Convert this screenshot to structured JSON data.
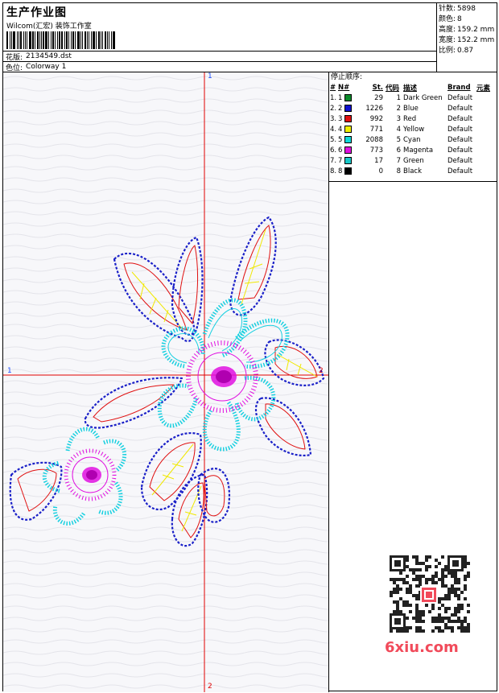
{
  "header": {
    "title": "生产作业图",
    "company": "Wilcom(汇宏) 装饰工作室",
    "file_label": "花版:",
    "file_name": "2134549.dst",
    "colorway_label": "色位:",
    "colorway_name": "Colorway 1"
  },
  "stats": [
    {
      "label": "针数:",
      "value": "5898"
    },
    {
      "label": "颜色:",
      "value": "8"
    },
    {
      "label": "高度:",
      "value": "159.2 mm"
    },
    {
      "label": "宽度:",
      "value": "152.2 mm"
    },
    {
      "label": "比例:",
      "value": "0.87"
    }
  ],
  "color_panel": {
    "title": "停止顺序:",
    "headers": [
      "#",
      "N#",
      "St.",
      "代码",
      "描述",
      "Brand",
      "元素"
    ],
    "rows": [
      {
        "n": "1.",
        "nn": "1",
        "color": "#0a8a2a",
        "st": "29",
        "code": "1",
        "desc": "Dark Green",
        "brand": "Default"
      },
      {
        "n": "2.",
        "nn": "2",
        "color": "#1010d0",
        "st": "1226",
        "code": "2",
        "desc": "Blue",
        "brand": "Default"
      },
      {
        "n": "3.",
        "nn": "3",
        "color": "#e01010",
        "st": "992",
        "code": "3",
        "desc": "Red",
        "brand": "Default"
      },
      {
        "n": "4.",
        "nn": "4",
        "color": "#f0f000",
        "st": "771",
        "code": "4",
        "desc": "Yellow",
        "brand": "Default"
      },
      {
        "n": "5.",
        "nn": "5",
        "color": "#10d8d8",
        "st": "2088",
        "code": "5",
        "desc": "Cyan",
        "brand": "Default"
      },
      {
        "n": "6.",
        "nn": "6",
        "color": "#e010e0",
        "st": "773",
        "code": "6",
        "desc": "Magenta",
        "brand": "Default"
      },
      {
        "n": "7.",
        "nn": "7",
        "color": "#18c8c8",
        "st": "17",
        "code": "7",
        "desc": "Green",
        "brand": "Default"
      },
      {
        "n": "8.",
        "nn": "8",
        "color": "#000000",
        "st": "0",
        "code": "8",
        "desc": "Black",
        "brand": "Default"
      }
    ]
  },
  "axes": {
    "top": "1",
    "left": "1",
    "right": "2",
    "bottom": "2"
  },
  "watermark": "6xiu.com",
  "colors": {
    "red_axis": "#e00000",
    "blue_outline": "#1a20c8",
    "cyan": "#18d0e0",
    "magenta": "#e010e0",
    "yellow": "#f0e800"
  }
}
